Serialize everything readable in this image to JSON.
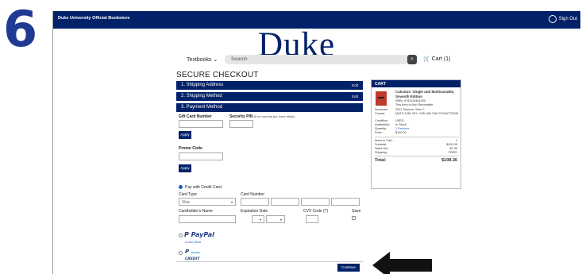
{
  "step_number": "6",
  "topbar": {
    "store_name": "Duke University Official Bookstore",
    "sign_out": "Sign Out"
  },
  "logo": "Duke",
  "nav": {
    "textbooks": "Textbooks",
    "search_placeholder": "Search",
    "cart": "Cart (1)"
  },
  "checkout": {
    "title": "SECURE CHECKOUT",
    "steps": [
      {
        "label": "1. Shipping Address",
        "edit": "Edit"
      },
      {
        "label": "2. Shipping Method",
        "edit": "Edit"
      },
      {
        "label": "3. Payment Method"
      }
    ],
    "gift_card_label": "Gift Card Number",
    "security_pin_label": "Security PIN",
    "security_pin_note": "(if no security pin, leave blank)",
    "apply_label": "Apply",
    "promo_label": "Promo Code",
    "pay_credit_label": "Pay with Credit Card",
    "card_type_label": "Card Type",
    "card_type_value": "Visa",
    "card_number_label": "Card Number",
    "cardholder_label": "Cardholder's Name",
    "expiration_label": "Expiration Date",
    "cvv_label": "CVV Code (?)",
    "save_label": "Save",
    "paypal_label": "PayPal",
    "paypal_learn_more": "Learn More",
    "paypal_credit_small": "PayPal",
    "paypal_credit_label": "CREDIT",
    "continue_label": "Continue"
  },
  "cart": {
    "header": "CART",
    "book_title": "Calculus: Single and Multivariable, Seventh Edition",
    "isbn": "ISBN: 9781119444190",
    "returnable": "This Item is Non-Returnable",
    "semester_label": "Semester:",
    "semester_value": "2022 Summer Term 2",
    "course_label": "Course:",
    "course_value": "MATH 108L 001 / 208 LAB CALC/FUNCTIONS",
    "condition_label": "Condition:",
    "condition_value": "USED",
    "availability_label": "Availability:",
    "availability_value": "In Stock",
    "quantity_label": "Quantity:",
    "quantity_value": "1 Remove",
    "price_label": "Price:",
    "price_value": "$100.00",
    "items_label": "Items in Cart:",
    "items_value": "1",
    "subtotal_label": "Subtotal:",
    "subtotal_value": "$100.00",
    "tax_label": "Sales Tax:",
    "tax_value": "$7.36",
    "shipping_label": "Shipping:",
    "shipping_value": "FREE!",
    "total_label": "Total:",
    "total_value": "$108.36"
  },
  "colors": {
    "duke_blue": "#012169",
    "step_number": "#1f3a93"
  },
  "icons": [
    "user-icon",
    "chevron-down-icon",
    "search-icon",
    "cart-icon",
    "arrow-pointer-icon"
  ]
}
